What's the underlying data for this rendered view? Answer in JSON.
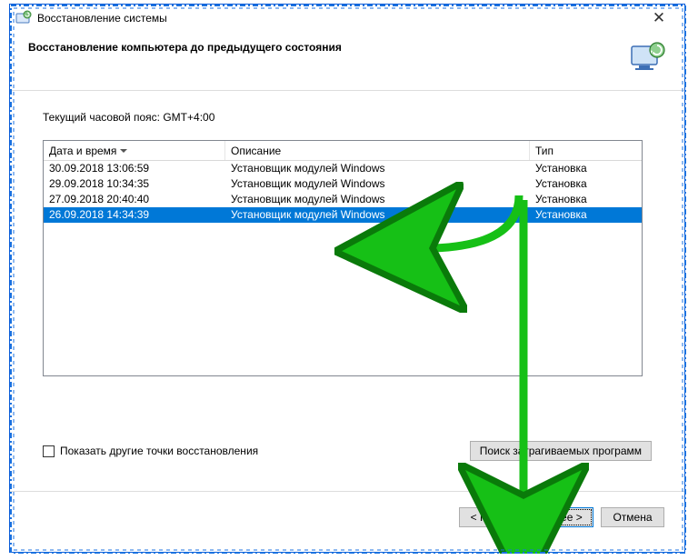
{
  "window": {
    "title": "Восстановление системы",
    "header": "Восстановление компьютера до предыдущего состояния",
    "timezone_label": "Текущий часовой пояс: GMT+4:00"
  },
  "table": {
    "columns": {
      "datetime": "Дата и время",
      "description": "Описание",
      "type": "Тип"
    },
    "rows": [
      {
        "dt": "30.09.2018 13:06:59",
        "desc": "Установщик модулей Windows",
        "type": "Установка",
        "selected": false
      },
      {
        "dt": "29.09.2018 10:34:35",
        "desc": "Установщик модулей Windows",
        "type": "Установка",
        "selected": false
      },
      {
        "dt": "27.09.2018 20:40:40",
        "desc": "Установщик модулей Windows",
        "type": "Установка",
        "selected": false
      },
      {
        "dt": "26.09.2018 14:34:39",
        "desc": "Установщик модулей Windows",
        "type": "Установка",
        "selected": true
      }
    ]
  },
  "controls": {
    "show_more_label": "Показать другие точки восстановления",
    "scan_programs_label": "Поиск затрагиваемых программ",
    "back_label": "< Назад",
    "next_label": "Далее >",
    "cancel_label": "Отмена"
  }
}
